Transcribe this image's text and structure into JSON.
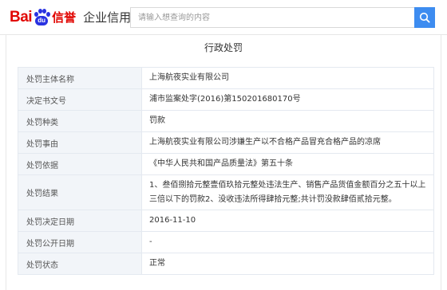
{
  "header": {
    "logo": {
      "bai": "Bai",
      "du": "du",
      "xinyu": "信誉",
      "subtitle": "企业信用"
    },
    "search": {
      "placeholder": "请输入想查询的内容",
      "value": ""
    },
    "icons": {
      "search_button": "search-icon"
    },
    "colors": {
      "brand_red": "#e10602",
      "brand_blue": "#2932e1",
      "search_button": "#3d8cf0"
    }
  },
  "page": {
    "title": "行政处罚"
  },
  "table": {
    "rows": [
      {
        "label": "处罚主体名称",
        "value": "上海航夜实业有限公司"
      },
      {
        "label": "决定书文号",
        "value": "浦市监案处字(2016)第150201680170号"
      },
      {
        "label": "处罚种类",
        "value": "罚款"
      },
      {
        "label": "处罚事由",
        "value": "上海航夜实业有限公司涉嫌生产以不合格产品冒充合格产品的凉席"
      },
      {
        "label": "处罚依据",
        "value": "《中华人民共和国产品质量法》第五十条"
      },
      {
        "label": "处罚结果",
        "value": "1、叁佰捌拾元整壹佰玖拾元整处违法生产、销售产品货值金额百分之五十以上三倍以下的罚款2、没收违法所得肆拾元整;共计罚没款肆佰贰拾元整。"
      },
      {
        "label": "处罚决定日期",
        "value": "2016-11-10"
      },
      {
        "label": "处罚公开日期",
        "value": "-"
      },
      {
        "label": "处罚状态",
        "value": "正常"
      }
    ]
  }
}
